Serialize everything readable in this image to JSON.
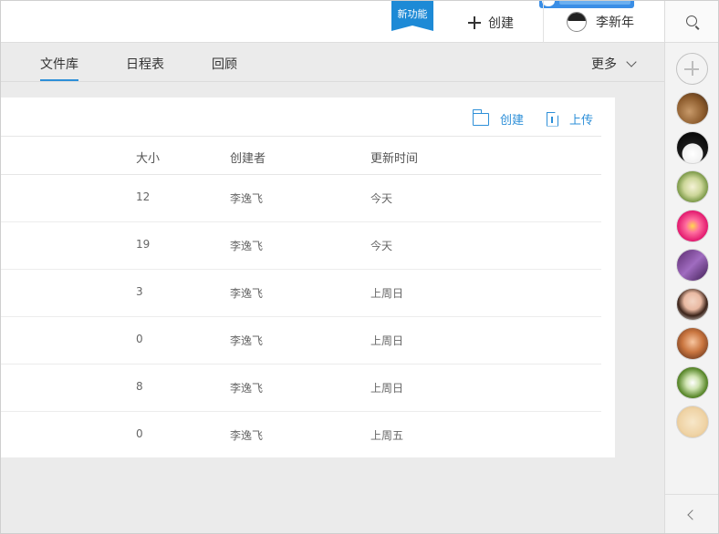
{
  "header": {
    "new_feature_badge": "新功能",
    "create_label": "创建",
    "user_name": "李新年"
  },
  "tabs": [
    {
      "label": "文件库",
      "active": true
    },
    {
      "label": "日程表",
      "active": false
    },
    {
      "label": "回顾",
      "active": false
    }
  ],
  "more_label": "更多",
  "file_actions": {
    "create_label": "创建",
    "upload_label": "上传"
  },
  "table": {
    "columns": [
      "大小",
      "创建者",
      "更新时间"
    ],
    "rows": [
      {
        "size": "12",
        "creator": "李逸飞",
        "updated": "今天"
      },
      {
        "size": "19",
        "creator": "李逸飞",
        "updated": "今天"
      },
      {
        "size": "3",
        "creator": "李逸飞",
        "updated": "上周日"
      },
      {
        "size": "0",
        "creator": "李逸飞",
        "updated": "上周日"
      },
      {
        "size": "8",
        "creator": "李逸飞",
        "updated": "上周日"
      },
      {
        "size": "0",
        "creator": "李逸飞",
        "updated": "上周五"
      }
    ]
  },
  "colors": {
    "accent": "#2d8fd8",
    "badge_blue": "#1d8ad6",
    "page_bg": "#ebebeb"
  },
  "icons": [
    "plus-icon",
    "search-icon",
    "add-member-icon",
    "folder-icon",
    "upload-icon",
    "chevron-down-icon",
    "chevron-left-icon"
  ]
}
